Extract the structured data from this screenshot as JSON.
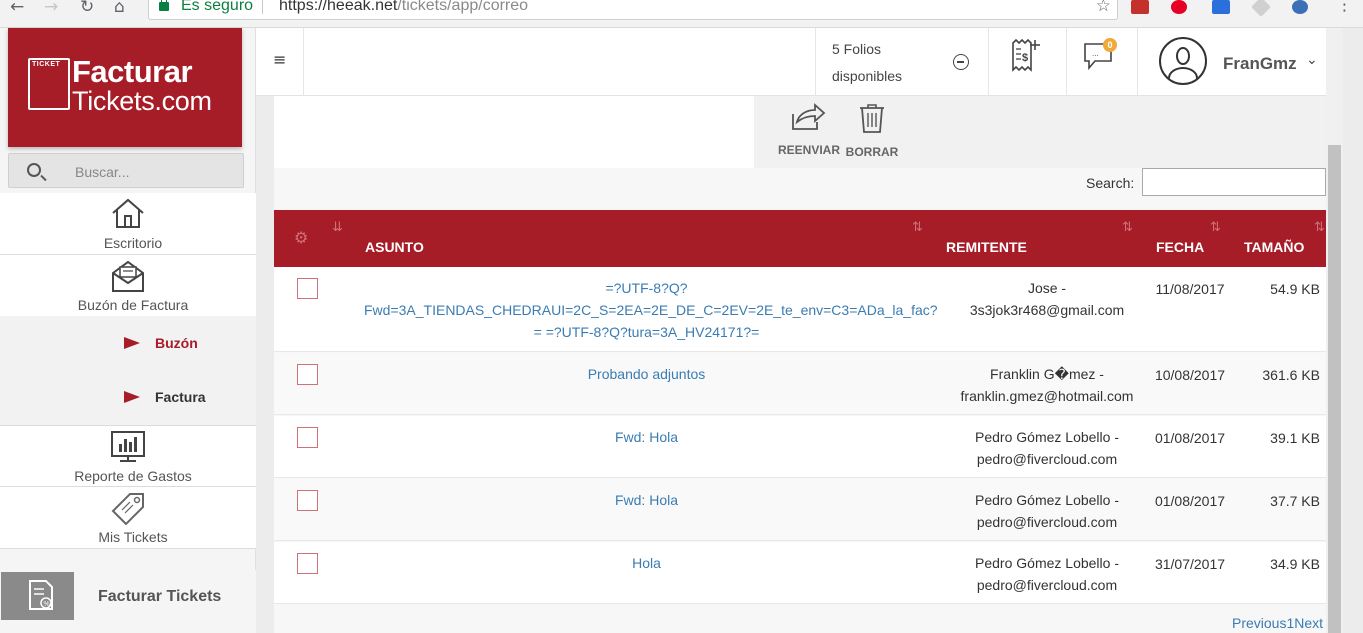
{
  "browser": {
    "secure_label": "Es seguro",
    "url_host": "https://heeak.net",
    "url_path": "/tickets/app/correo",
    "back_icon": "←",
    "forward_icon": "→",
    "reload_icon": "↻",
    "home_icon": "⌂",
    "star_icon": "☆"
  },
  "brand": {
    "mark_label": "TICKET",
    "line1": "Facturar",
    "line2": "Tickets.com",
    "color": "#a61c27"
  },
  "sidebar": {
    "search_placeholder": "Buscar...",
    "items": [
      {
        "label": "Escritorio",
        "icon": "home-icon"
      },
      {
        "label": "Buzón de Factura",
        "icon": "mail-icon"
      },
      {
        "label": "Reporte de Gastos",
        "icon": "chart-icon"
      },
      {
        "label": "Mis Tickets",
        "icon": "tag-icon"
      }
    ],
    "subitems": [
      {
        "label": "Buzón",
        "active": true
      },
      {
        "label": "Factura",
        "active": false
      }
    ],
    "bottom_label": "Facturar Tickets"
  },
  "header": {
    "menu_icon": "≡",
    "folios_line1": "5 Folios",
    "folios_line2": "disponibles",
    "notifications_count": "0",
    "username": "FranGmz",
    "chevron": "⌄"
  },
  "toolbar": {
    "forward_label": "REENVIAR",
    "delete_label": "BORRAR",
    "search_label": "Search:"
  },
  "table": {
    "columns": [
      "ASUNTO",
      "REMITENTE",
      "FECHA",
      "TAMAÑO"
    ],
    "rows": [
      {
        "subject": "=?UTF-8?Q?Fwd=3A_TIENDAS_CHEDRAUI=2C_S=2EA=2E_DE_C=2EV=2E_te_env=C3=ADa_la_fac?= =?UTF-8?Q?tura=3A_HV24171?=",
        "subject_lines": [
          "=?UTF-8?Q?",
          "Fwd=3A_TIENDAS_CHEDRAUI=2C_S=2EA=2E_DE_C=2EV=2E_te_env=C3=ADa_la_fac?",
          "= =?UTF-8?Q?tura=3A_HV24171?="
        ],
        "sender_lines": [
          "Jose -",
          "3s3jok3r468@gmail.com"
        ],
        "date": "11/08/2017",
        "size": "54.9 KB"
      },
      {
        "subject_lines": [
          "Probando adjuntos"
        ],
        "sender_lines": [
          "Franklin G�mez -",
          "franklin.gmez@hotmail.com"
        ],
        "date": "10/08/2017",
        "size": "361.6 KB"
      },
      {
        "subject_lines": [
          "Fwd: Hola"
        ],
        "sender_lines": [
          "Pedro Gómez Lobello -",
          "pedro@fivercloud.com"
        ],
        "date": "01/08/2017",
        "size": "39.1 KB"
      },
      {
        "subject_lines": [
          "Fwd: Hola"
        ],
        "sender_lines": [
          "Pedro Gómez Lobello -",
          "pedro@fivercloud.com"
        ],
        "date": "01/08/2017",
        "size": "37.7 KB"
      },
      {
        "subject_lines": [
          "Hola"
        ],
        "sender_lines": [
          "Pedro Gómez Lobello -",
          "pedro@fivercloud.com"
        ],
        "date": "31/07/2017",
        "size": "34.9 KB"
      }
    ]
  },
  "pager": {
    "previous": "Previous",
    "page": "1",
    "next": "Next"
  }
}
